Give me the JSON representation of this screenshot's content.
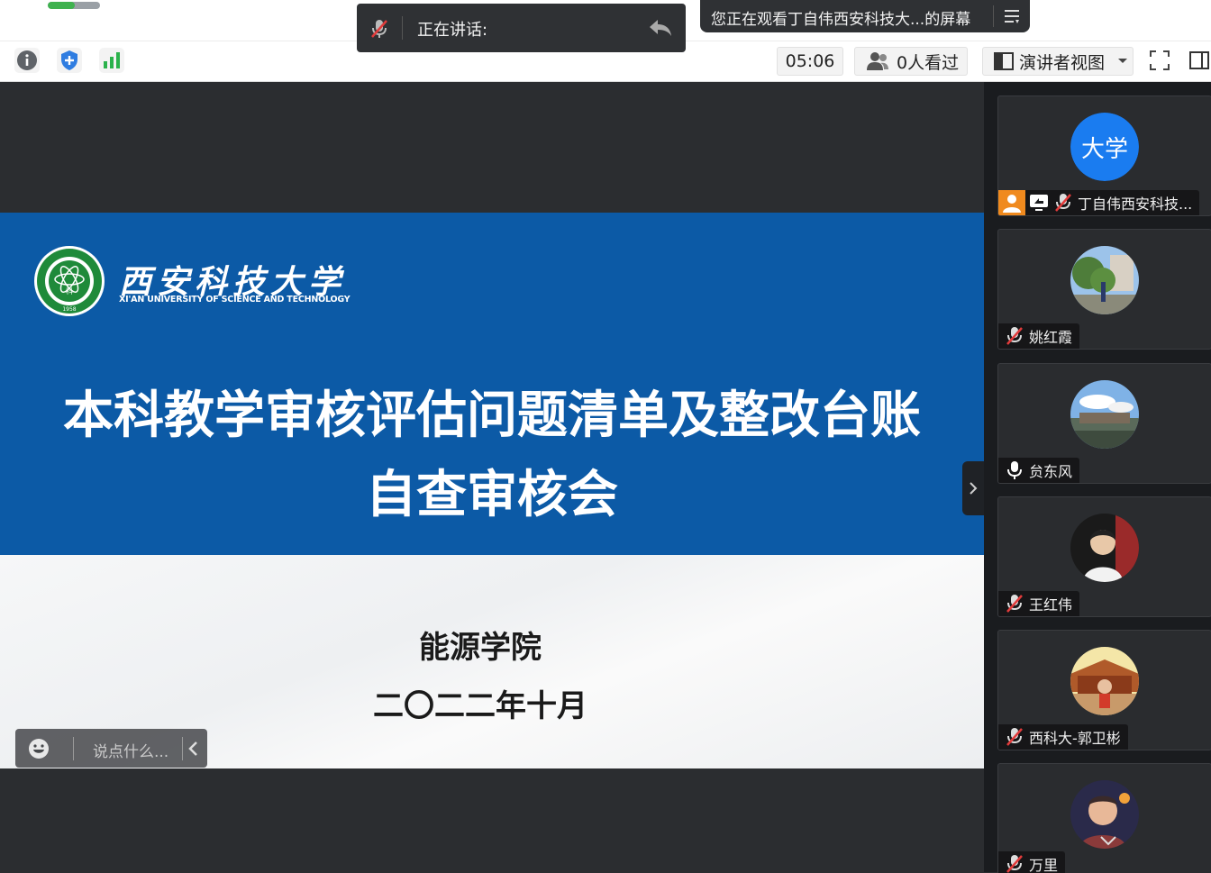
{
  "toolbar": {
    "progress_fraction": 0.52,
    "speaking_label": "正在讲话:",
    "viewing_text": "您正在观看丁自伟西安科技大...的屏幕",
    "timer": "05:06",
    "viewers": "0人看过",
    "presenter_view": "演讲者视图"
  },
  "slide": {
    "university_cn": "西安科技大学",
    "university_en": "XI'AN UNIVERSITY OF SCIENCE AND TECHNOLOGY",
    "emblem_year": "1958",
    "emblem_mark": "科",
    "title_line1": "本科教学审核评估问题清单及整改台账",
    "title_line2": "自查审核会",
    "college": "能源学院",
    "date": "二〇二二年十月"
  },
  "chat": {
    "placeholder": "说点什么..."
  },
  "participants": [
    {
      "name": "丁自伟西安科技...",
      "avatar_text": "大学",
      "mic": "muted",
      "host": true,
      "sharing": true
    },
    {
      "name": "姚红霞",
      "mic": "muted"
    },
    {
      "name": "贠东风",
      "mic": "on"
    },
    {
      "name": "王红伟",
      "mic": "muted"
    },
    {
      "name": "西科大-郭卫彬",
      "mic": "muted"
    },
    {
      "name": "万里",
      "mic": "muted"
    }
  ],
  "colors": {
    "slide_blue": "#0c5aa6",
    "avatar_blue": "#1a7cf0",
    "host_orange": "#f08a1e",
    "signal_green": "#2bb24c",
    "shield_blue": "#2f7de1"
  }
}
